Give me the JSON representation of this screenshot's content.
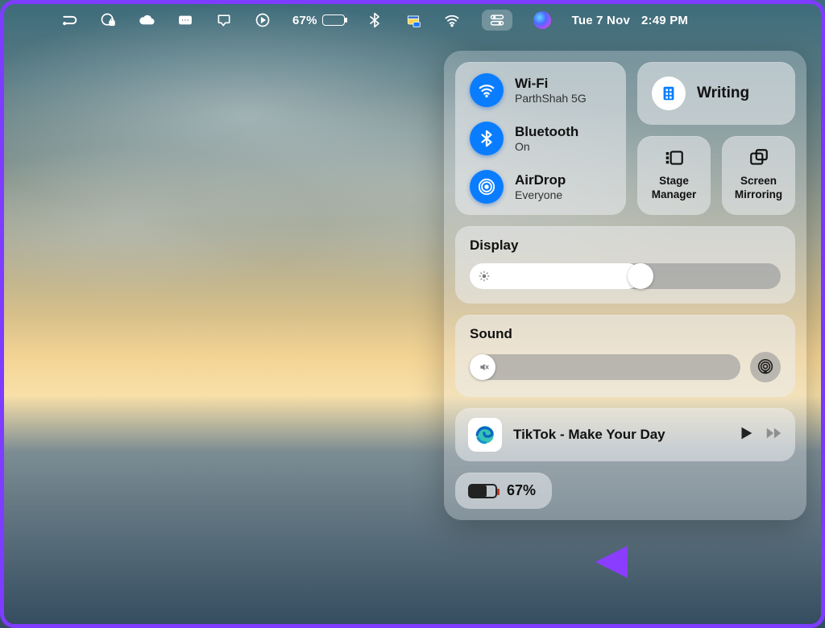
{
  "menubar": {
    "battery_pct": "67%",
    "battery_level": 67,
    "date": "Tue 7 Nov",
    "time": "2:49 PM"
  },
  "cc": {
    "wifi": {
      "title": "Wi-Fi",
      "subtitle": "ParthShah 5G"
    },
    "bluetooth": {
      "title": "Bluetooth",
      "subtitle": "On"
    },
    "airdrop": {
      "title": "AirDrop",
      "subtitle": "Everyone"
    },
    "focus": {
      "label": "Writing"
    },
    "stage": {
      "label": "Stage\nManager"
    },
    "mirror": {
      "label": "Screen\nMirroring"
    },
    "display": {
      "title": "Display",
      "value": 55
    },
    "sound": {
      "title": "Sound",
      "value": 0
    },
    "nowplaying": {
      "title": "TikTok - Make Your Day"
    },
    "battery": {
      "pct": "67%",
      "level": 67
    }
  }
}
